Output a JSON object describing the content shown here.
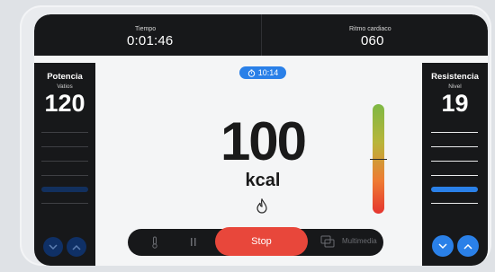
{
  "top": {
    "time_label": "Tiempo",
    "time_value": "0:01:46",
    "heart_label": "Ritmo cardiaco",
    "heart_value": "060"
  },
  "left_panel": {
    "title": "Potencia",
    "unit": "Vatios",
    "value": "120",
    "level_fraction": 0.35
  },
  "right_panel": {
    "title": "Resistencia",
    "unit": "Nivel",
    "value": "19",
    "level_fraction": 0.38
  },
  "center": {
    "timer_chip": "10:14",
    "value": "100",
    "unit": "kcal",
    "gauge_level": 0.5
  },
  "bottom": {
    "stop_label": "Stop",
    "multimedia_label": "Multimedia"
  },
  "colors": {
    "accent_blue": "#2a80e8",
    "stop_red": "#e8473b",
    "panel_dark": "#17181a"
  },
  "icons": {
    "arrow_down": "chevron-down-icon",
    "arrow_up": "chevron-up-icon",
    "thermometer": "thermometer-icon",
    "pause": "pause-icon",
    "flame": "flame-icon",
    "timer": "stopwatch-icon",
    "multimedia": "media-icon"
  }
}
